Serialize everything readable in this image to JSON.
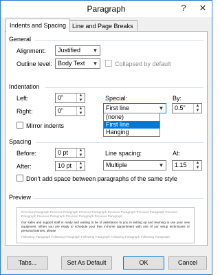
{
  "window": {
    "title": "Paragraph",
    "help_glyph": "?",
    "close_glyph": "✕"
  },
  "tabs": [
    {
      "label": "Indents and Spacing",
      "active": true
    },
    {
      "label": "Line and Page Breaks",
      "active": false
    }
  ],
  "general": {
    "title": "General",
    "alignment_label": "Alignment:",
    "alignment_value": "Justified",
    "outline_label": "Outline level:",
    "outline_value": "Body Text",
    "collapsed_label": "Collapsed by default"
  },
  "indentation": {
    "title": "Indentation",
    "left_label": "Left:",
    "left_value": "0\"",
    "right_label": "Right:",
    "right_value": "0\"",
    "mirror_label": "Mirror indents",
    "special_label": "Special:",
    "special_value": "First line",
    "special_options": [
      "(none)",
      "First line",
      "Hanging"
    ],
    "by_label": "By:",
    "by_value": "0.5\""
  },
  "spacing": {
    "title": "Spacing",
    "before_label": "Before:",
    "before_value": "0 pt",
    "after_label": "After:",
    "after_value": "10 pt",
    "line_spacing_label": "Line spacing:",
    "line_spacing_value": "Multiple",
    "at_label": "At:",
    "at_value": "1.15",
    "dont_add_label": "Don't add space between paragraphs of the same style"
  },
  "preview": {
    "title": "Preview",
    "previous_text": "Previous Paragraph Previous Paragraph Previous Paragraph Previous Paragraph Previous Paragraph Previous Paragraph Previous Paragraph Previous Paragraph Previous Paragraph",
    "main_text": "Our sales and support staff is ready and waiting to be of assistance to you in setting up and learning to use your new equipment. When you are ready to schedule your free in-home appointment with one of our setup technicians or personal trainers, please",
    "following_text": "Following Paragraph Following Paragraph Following Paragraph Following Paragraph Following Paragraph"
  },
  "buttons": {
    "tabs": "Tabs...",
    "set_default": "Set As Default",
    "ok": "OK",
    "cancel": "Cancel"
  }
}
